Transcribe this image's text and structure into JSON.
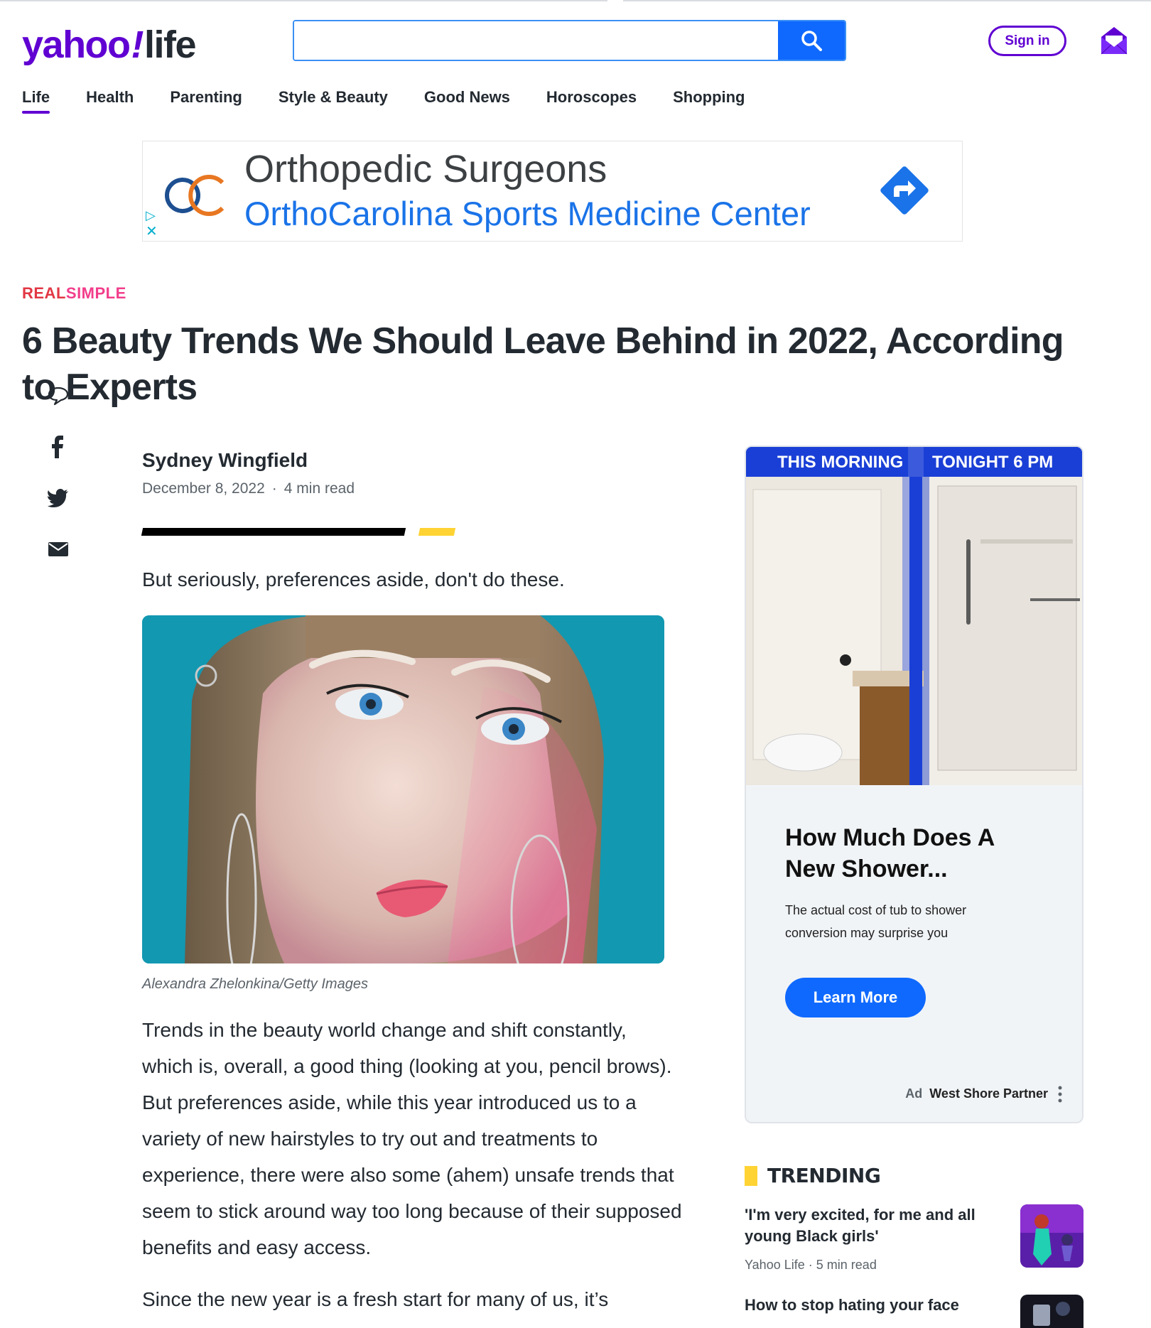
{
  "brand": {
    "yahoo": "yahoo",
    "bang": "!",
    "life": "life"
  },
  "search": {
    "value": "",
    "placeholder": ""
  },
  "header": {
    "signin_label": "Sign in"
  },
  "nav": {
    "items": [
      {
        "label": "Life",
        "active": true
      },
      {
        "label": "Health"
      },
      {
        "label": "Parenting"
      },
      {
        "label": "Style & Beauty"
      },
      {
        "label": "Good News"
      },
      {
        "label": "Horoscopes"
      },
      {
        "label": "Shopping"
      }
    ]
  },
  "top_ad": {
    "title": "Orthopedic Surgeons",
    "subtitle": "OrthoCarolina Sports Medicine Center"
  },
  "article": {
    "source_part1": "REAL",
    "source_part2": "SIMPLE",
    "headline": "6 Beauty Trends We Should Leave Behind in 2022, According to Experts",
    "author": "Sydney Wingfield",
    "date": "December 8, 2022",
    "dot": "·",
    "read_time": "4 min read",
    "summary": "But seriously, preferences aside, don't do these.",
    "caption": "Alexandra Zhelonkina/Getty Images",
    "paragraph1": "Trends in the beauty world change and shift constantly, which is, overall, a good thing (looking at you, pencil brows). But preferences aside, while this year introduced us to a variety of new hairstyles to try out and treatments to experience, there were also some (ahem) unsafe trends that seem to stick around way too long because of their supposed benefits and easy access.",
    "paragraph2": "Since the new year is a fresh start for many of us, it’s"
  },
  "side_ad": {
    "label_left": "THIS MORNING",
    "label_right": "TONIGHT 6 PM",
    "headline": "How Much Does A New Shower...",
    "description": "The actual cost of tub to shower conversion may surprise you",
    "cta": "Learn More",
    "ad_tag": "Ad",
    "advertiser": "West Shore Partner"
  },
  "trending": {
    "title": "TRENDING",
    "items": [
      {
        "title": "'I'm very excited, for me and all young Black girls'",
        "source": "Yahoo Life",
        "dot": "·",
        "read_time": "5 min read"
      },
      {
        "title": "How to stop hating your face"
      }
    ]
  },
  "colors": {
    "brand_purple": "#6001d2",
    "search_blue": "#0f69ff",
    "cta_blue": "#0f69ff",
    "accent_yellow": "#ffd333"
  }
}
